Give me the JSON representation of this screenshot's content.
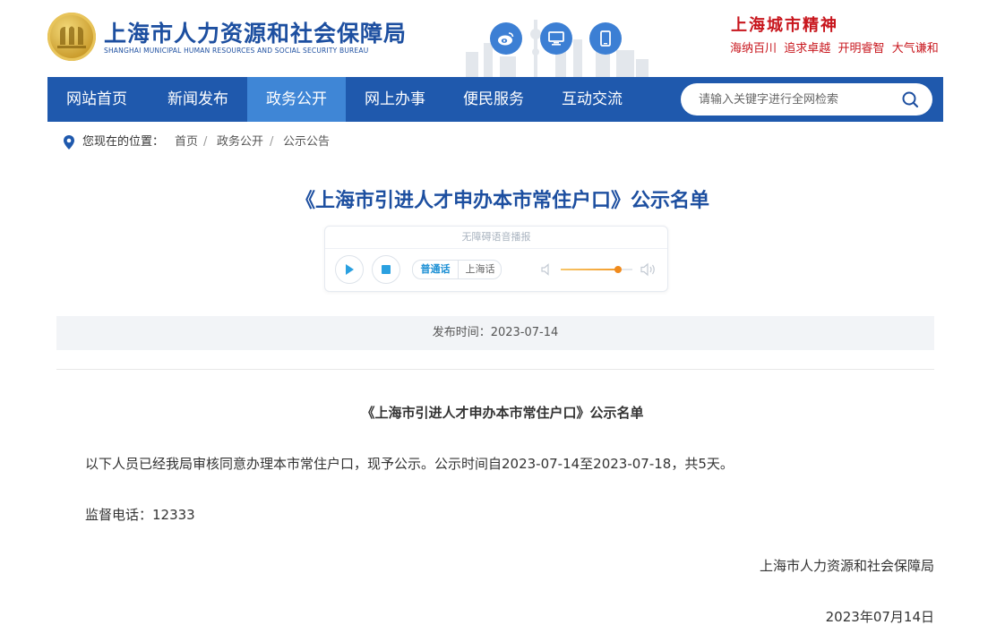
{
  "header": {
    "logo_cn": "上海市人力资源和社会保障局",
    "logo_en": "SHANGHAI MUNICIPAL HUMAN RESOURCES AND SOCIAL SECURITY BUREAU",
    "icons": [
      "weibo-icon",
      "desktop-icon",
      "mobile-icon"
    ],
    "spirit_title": "上海城市精神",
    "spirit_motto": "海纳百川  追求卓越  开明睿智  大气谦和"
  },
  "nav": {
    "items": [
      {
        "label": "网站首页",
        "active": false
      },
      {
        "label": "新闻发布",
        "active": false
      },
      {
        "label": "政务公开",
        "active": true
      },
      {
        "label": "网上办事",
        "active": false
      },
      {
        "label": "便民服务",
        "active": false
      },
      {
        "label": "互动交流",
        "active": false
      }
    ],
    "search_placeholder": "请输入关键字进行全网检索"
  },
  "breadcrumb": {
    "prefix": "您现在的位置：",
    "items": [
      "首页",
      "政务公开",
      "公示公告"
    ],
    "separator": "/"
  },
  "page_title": "《上海市引进人才申办本市常住户口》公示名单",
  "player": {
    "header": "无障碍语音播报",
    "lang_options": [
      "普通话",
      "上海话"
    ],
    "lang_selected": "普通话",
    "volume_level": 0.8
  },
  "publish": {
    "label": "发布时间：",
    "date": "2023-07-14"
  },
  "article": {
    "title": "《上海市引进人才申办本市常住户口》公示名单",
    "paragraph": "以下人员已经我局审核同意办理本市常住户口，现予公示。公示时间自2023-07-14至2023-07-18，共5天。",
    "phone_line": "监督电话：12333",
    "signature": "上海市人力资源和社会保障局",
    "sign_date": "2023年07月14日"
  },
  "colors": {
    "brand_blue": "#1d4fa0",
    "nav_bg": "#1f59ad",
    "nav_active": "#3f86d6",
    "accent_red": "#c8161d",
    "volume": "#f08a1c"
  }
}
